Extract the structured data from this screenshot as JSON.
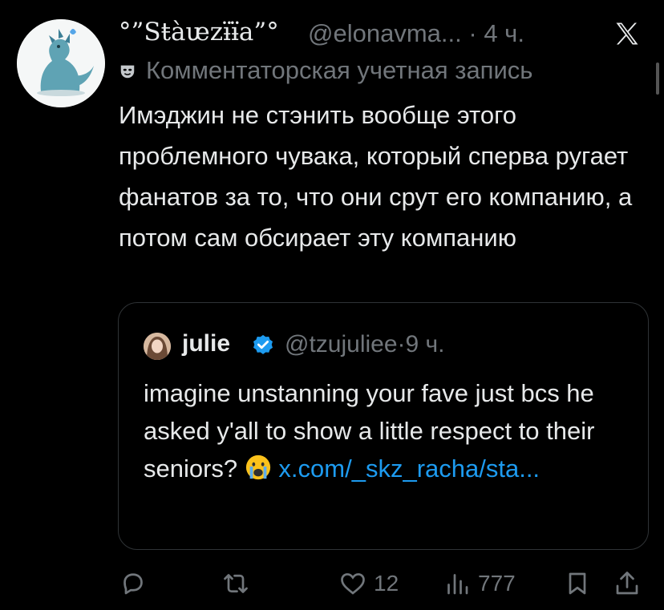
{
  "tweet": {
    "author_name": "°”Sŧàᵫzɨ̈ɨ̈a”°",
    "handle": "@elonavma...",
    "separator": "·",
    "time": "4 ч.",
    "account_label": "Комментаторская учетная запись",
    "text": "Имэджин не стэнить вообще этого проблемного чувака, который сперва ругает фанатов за то, что они срут его компанию, а потом сам обсирает эту компанию"
  },
  "quoted": {
    "author_name": "julie",
    "handle": "@tzujuliee",
    "separator": "·",
    "time": "9 ч.",
    "text": "imagine unstanning your fave just bcs he asked y'all to show a little respect to their seniors? ",
    "link": "x.com/_skz_racha/sta..."
  },
  "actions": {
    "likes": "12",
    "views": "777"
  },
  "icons": [
    "x-logo-icon",
    "mask-icon",
    "verified-icon",
    "crying-emoji-icon",
    "reply-icon",
    "retweet-icon",
    "like-icon",
    "views-icon",
    "bookmark-icon",
    "share-icon"
  ],
  "colors": {
    "background": "#000000",
    "text": "#e7e9ea",
    "muted": "#71767b",
    "link": "#1d9bf0"
  }
}
